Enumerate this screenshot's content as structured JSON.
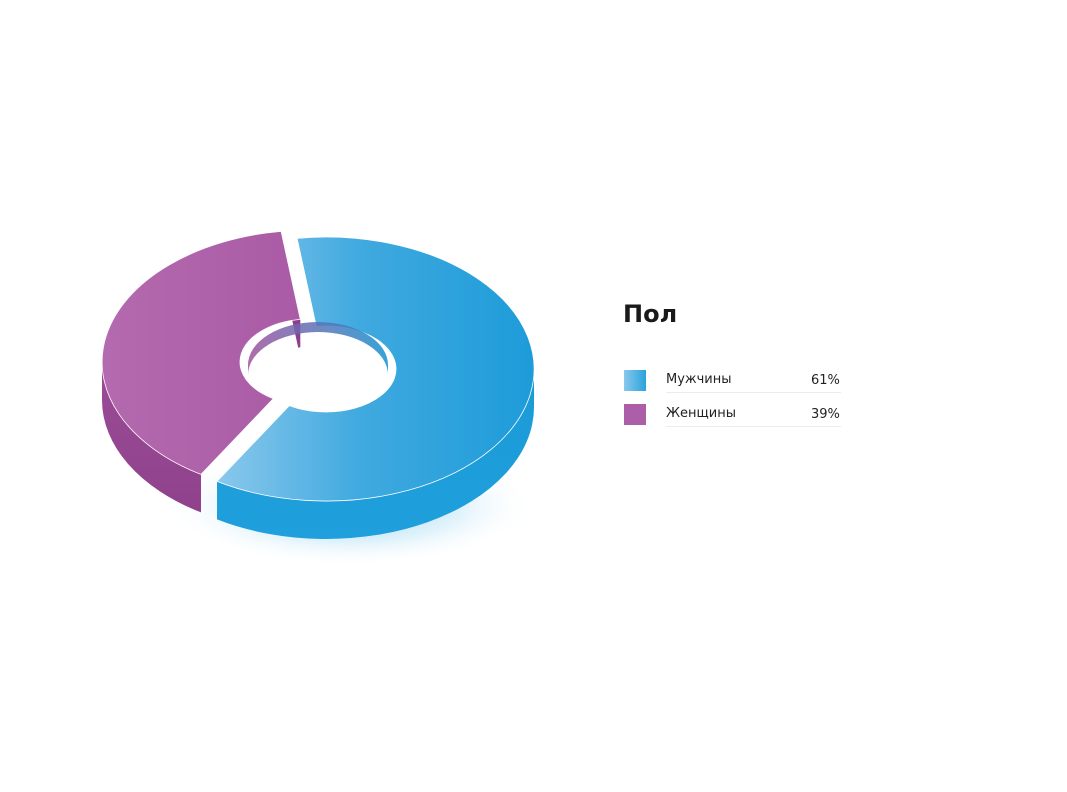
{
  "chart_data": {
    "type": "pie",
    "title": "Пол",
    "categories": [
      "Мужчины",
      "Женщины"
    ],
    "values": [
      61,
      39
    ],
    "value_labels": [
      "61%",
      "39%"
    ],
    "colors": [
      "#29a3dc",
      "#ac5ea8"
    ],
    "legend_position": "right",
    "style": "3d-donut"
  }
}
